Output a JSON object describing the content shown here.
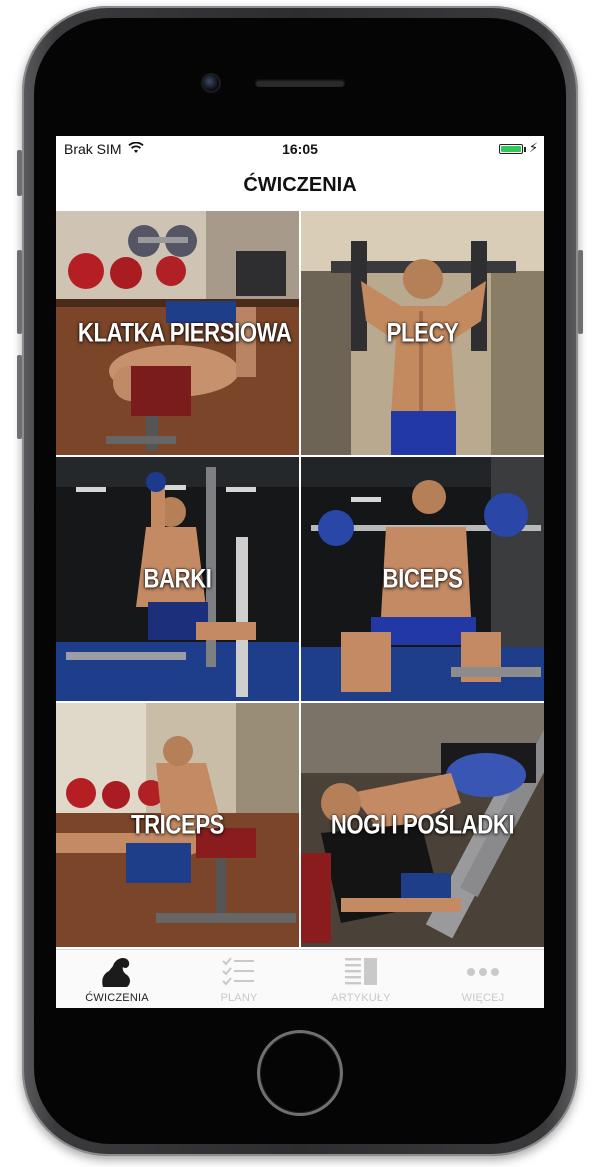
{
  "status": {
    "carrier": "Brak SIM",
    "time": "16:05"
  },
  "header": {
    "title": "ĆWICZENIA"
  },
  "tiles": [
    {
      "label": "KLATKA PIERSIOWA"
    },
    {
      "label": "PLECY"
    },
    {
      "label": "BARKI"
    },
    {
      "label": "BICEPS"
    },
    {
      "label": "TRICEPS"
    },
    {
      "label": "NOGI I POŚLADKI"
    }
  ],
  "tabs": [
    {
      "label": "ĆWICZENIA",
      "icon": "flexed-arm-icon"
    },
    {
      "label": "PLANY",
      "icon": "checklist-icon"
    },
    {
      "label": "ARTYKUŁY",
      "icon": "articles-icon"
    },
    {
      "label": "WIĘCEJ",
      "icon": "more-dots-icon"
    }
  ],
  "colors": {
    "battery": "#34c759",
    "tab_active": "#222222",
    "tab_inactive": "#c9c9c9"
  }
}
